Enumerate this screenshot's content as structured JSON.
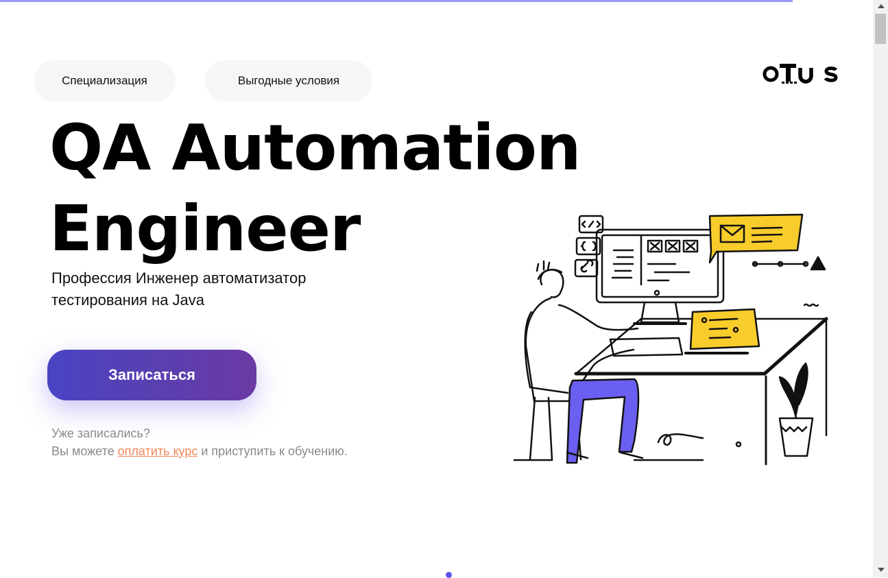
{
  "nav": {
    "specialization_label": "Специализация",
    "terms_label": "Выгодные условия"
  },
  "logo": {
    "text": "otus"
  },
  "hero": {
    "title_line1": "QA Automation",
    "title_line2": "Engineer",
    "subtitle": "Профессия Инженер автоматизатор тестирования на Java",
    "cta_label": "Записаться"
  },
  "already": {
    "question": "Уже записались?",
    "prefix": "Вы можете ",
    "link_text": "оплатить курс",
    "suffix": " и приступить к обучению."
  },
  "colors": {
    "accent": "#5d55e8",
    "cta_start": "#4a44c4",
    "cta_end": "#6a3aa5",
    "link": "#f08a5d",
    "illustration_yellow": "#f8cc2a",
    "illustration_purple": "#6a5ff0"
  },
  "icons": [
    "logo-otus",
    "person-at-desk-illustration",
    "envelope-icon",
    "warning-icon",
    "code-tag-icon",
    "braces-icon",
    "link-icon"
  ]
}
